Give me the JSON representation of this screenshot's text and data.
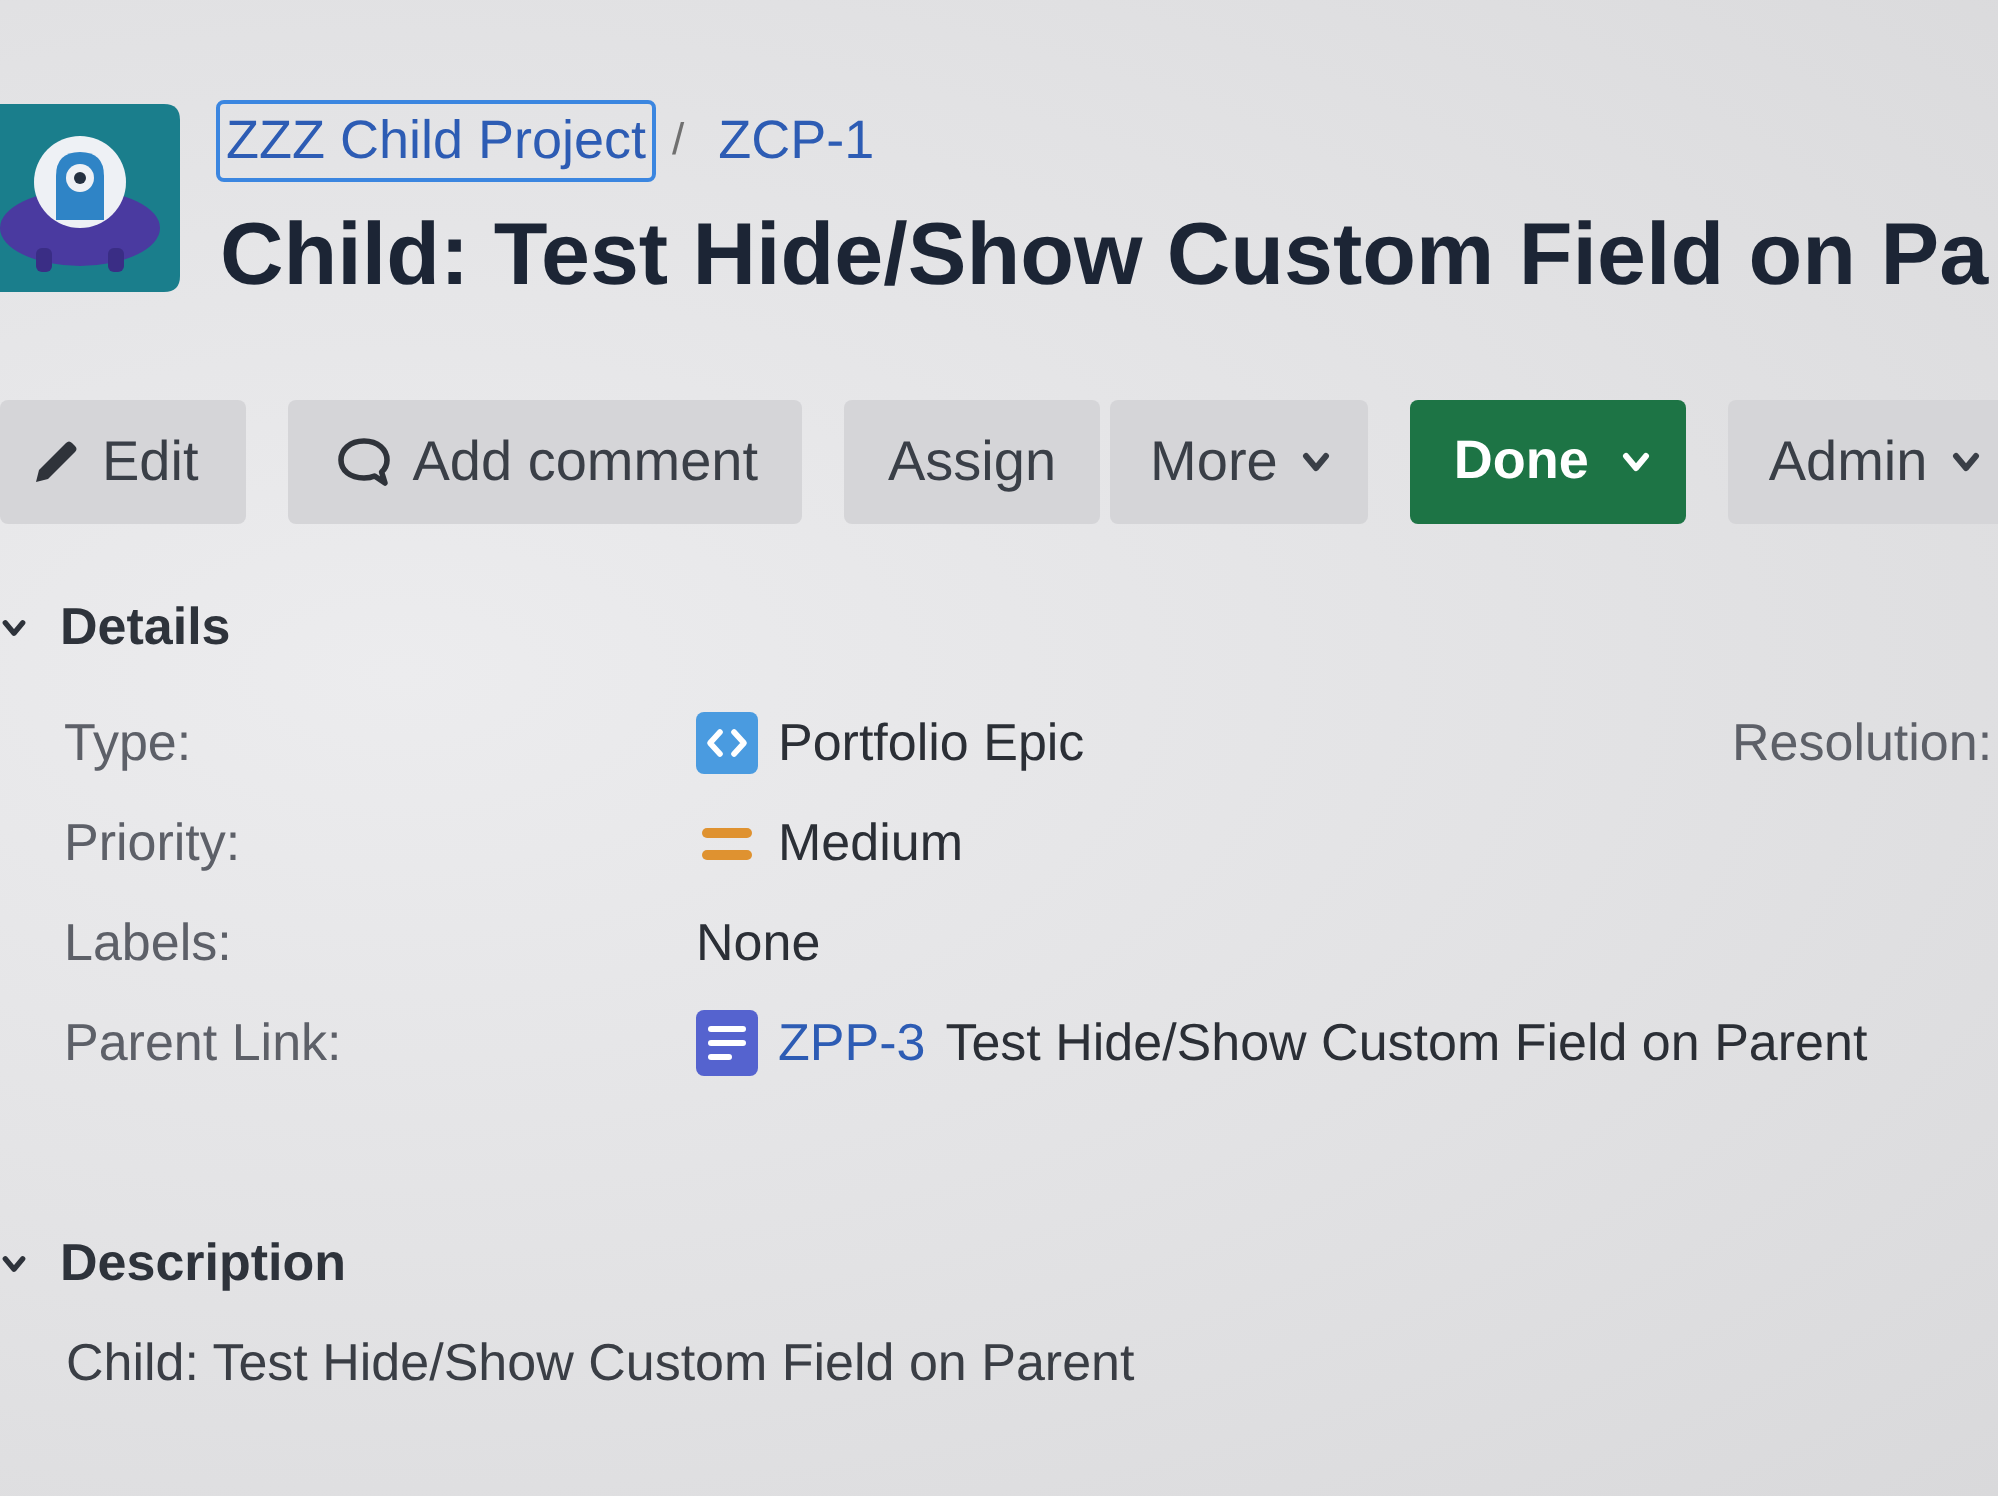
{
  "breadcrumbs": [
    {
      "label": "ZZZ Child Project",
      "focused": true
    },
    {
      "label": "ZCP-1",
      "focused": false
    }
  ],
  "breadcrumb_separator": "/",
  "title": "Child: Test Hide/Show Custom Field on Pa",
  "toolbar": [
    {
      "buttons": [
        {
          "label": "Edit",
          "kind": "edit"
        }
      ]
    },
    {
      "buttons": [
        {
          "label": "Add comment",
          "kind": "comment"
        }
      ]
    },
    {
      "buttons": [
        {
          "label": "Assign",
          "kind": "plain"
        },
        {
          "label": "More",
          "kind": "menu"
        }
      ]
    },
    {
      "buttons": [
        {
          "label": "Done",
          "kind": "status"
        }
      ]
    },
    {
      "buttons": [
        {
          "label": "Admin",
          "kind": "menu"
        }
      ]
    }
  ],
  "details": {
    "heading": "Details",
    "expanded": true,
    "fields": [
      {
        "label": "Type:",
        "kind": "type",
        "value": "Portfolio Epic"
      },
      {
        "label": "Priority:",
        "kind": "priority",
        "value": "Medium"
      },
      {
        "label": "Labels:",
        "kind": "text",
        "value": "None"
      },
      {
        "label": "Parent Link:",
        "kind": "issue",
        "issue_key": "ZPP-3",
        "value": "Test Hide/Show Custom Field on Parent"
      }
    ],
    "side_fields": [
      {
        "label": "Resolution:"
      }
    ]
  },
  "description": {
    "heading": "Description",
    "expanded": true,
    "text": "Child: Test Hide/Show Custom Field on Parent"
  }
}
